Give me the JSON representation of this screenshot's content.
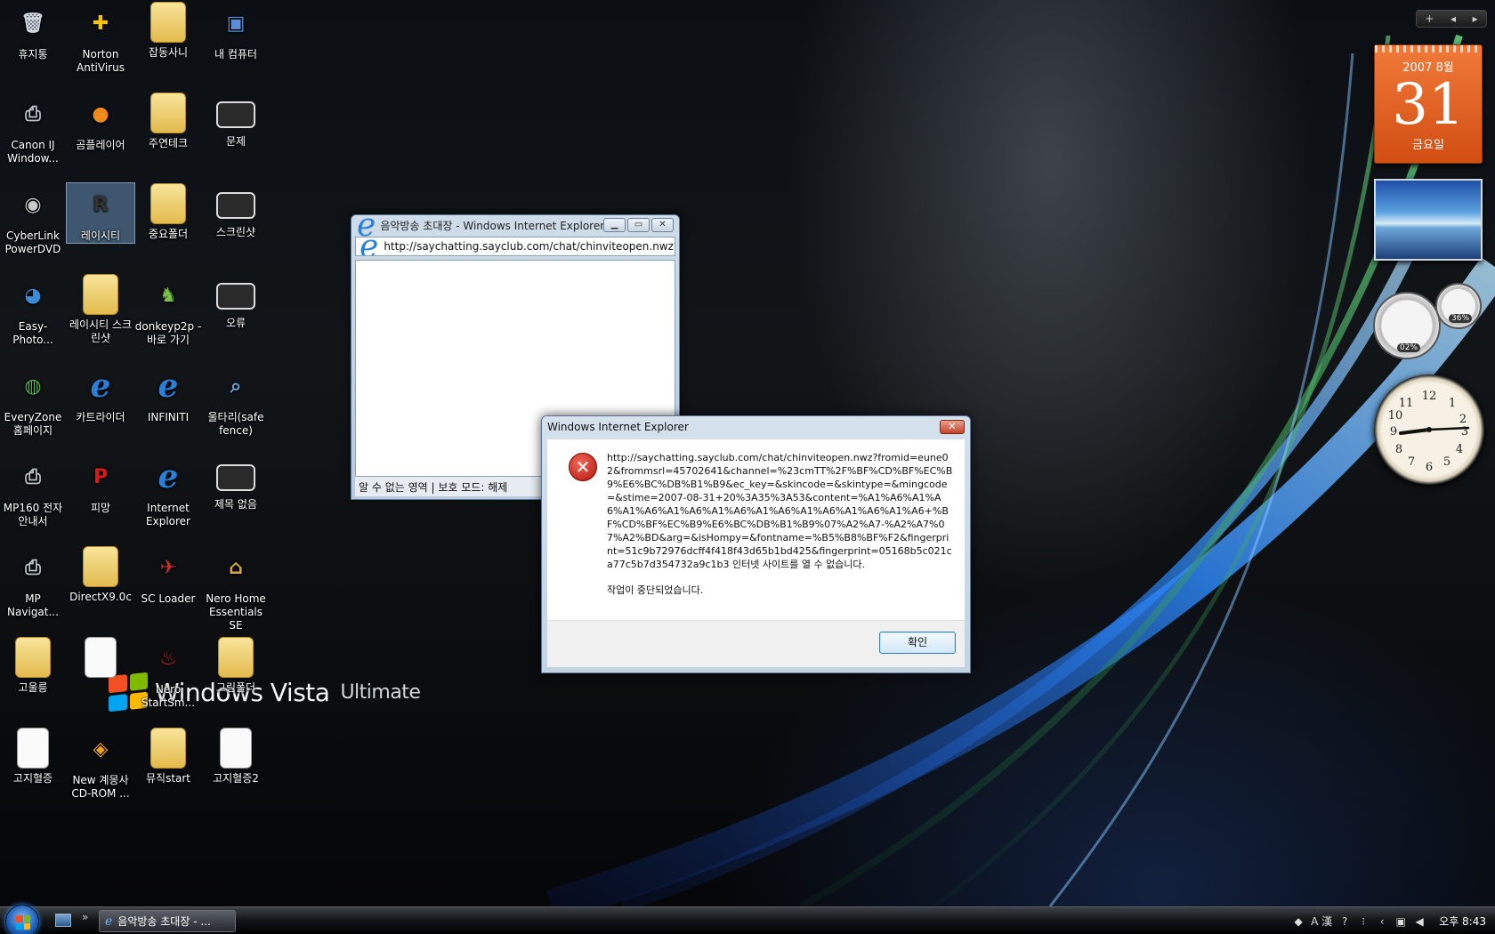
{
  "desktop": {
    "icons": [
      {
        "label": "휴지통",
        "icon": "recycle-bin-icon"
      },
      {
        "label": "Norton AntiVirus",
        "icon": "norton-icon"
      },
      {
        "label": "잡동사니",
        "icon": "folder-icon"
      },
      {
        "label": "내 컴퓨터",
        "icon": "computer-icon"
      },
      {
        "label": "Canon IJ Window...",
        "icon": "printer-icon"
      },
      {
        "label": "곰플레이어",
        "icon": "gom-player-icon"
      },
      {
        "label": "주연테크",
        "icon": "folder-icon"
      },
      {
        "label": "문제",
        "icon": "screenshot-icon"
      },
      {
        "label": "CyberLink PowerDVD",
        "icon": "dvd-icon"
      },
      {
        "label": "레이시티",
        "icon": "racity-icon"
      },
      {
        "label": "중요폴더",
        "icon": "folder-icon"
      },
      {
        "label": "스크린샷",
        "icon": "screenshot-icon"
      },
      {
        "label": "Easy-Photo...",
        "icon": "photo-icon"
      },
      {
        "label": "레이시티 스크린샷",
        "icon": "folder-icon"
      },
      {
        "label": "donkeyp2p - 바로 가기",
        "icon": "donkey-icon"
      },
      {
        "label": "오류",
        "icon": "screenshot-icon"
      },
      {
        "label": "EveryZone 홈페이지",
        "icon": "globe-icon"
      },
      {
        "label": "카트라이더",
        "icon": "ie-icon"
      },
      {
        "label": "INFINITI",
        "icon": "ie-icon"
      },
      {
        "label": "울타리(safe fence)",
        "icon": "magnifier-icon"
      },
      {
        "label": "MP160 전자 안내서",
        "icon": "printer-icon"
      },
      {
        "label": "피망",
        "icon": "pmang-icon"
      },
      {
        "label": "Internet Explorer",
        "icon": "ie-icon"
      },
      {
        "label": "제목 없음",
        "icon": "screenshot-icon"
      },
      {
        "label": "MP Navigat...",
        "icon": "printer-icon"
      },
      {
        "label": "DirectX9.0c",
        "icon": "folder-icon"
      },
      {
        "label": "SC Loader",
        "icon": "plane-icon"
      },
      {
        "label": "Nero Home Essentials SE",
        "icon": "nero-home-icon"
      },
      {
        "label": "고울릉",
        "icon": "folder-icon"
      },
      {
        "label": "",
        "icon": "document-icon"
      },
      {
        "label": "Nero StartSm...",
        "icon": "nero-icon"
      },
      {
        "label": "그림폴더",
        "icon": "folder-icon"
      },
      {
        "label": "고지혈증",
        "icon": "document-icon"
      },
      {
        "label": "New 계몽사 CD-ROM ...",
        "icon": "cdrom-icon"
      },
      {
        "label": "뮤직start",
        "icon": "folder-icon"
      },
      {
        "label": "고지혈증2",
        "icon": "document-icon"
      }
    ],
    "wallpaper_brand": "Windows Vista",
    "wallpaper_edition": "Ultimate"
  },
  "ie_window": {
    "title": "음악방송 초대장 - Windows Internet Explorer",
    "address": "http://saychatting.sayclub.com/chat/chinviteopen.nwz?fron",
    "status": "알 수 없는 영역 | 보호 모드: 해제"
  },
  "dialog": {
    "title": "Windows Internet Explorer",
    "message": "http://saychatting.sayclub.com/chat/chinviteopen.nwz?fromid=eune02&frommsrl=45702641&channel=%23cmTT%2F%BF%CD%BF%EC%B9%E6%BC%DB%B1%B9&ec_key=&skincode=&skintype=&mingcode=&stime=2007-08-31+20%3A35%3A53&content=%A1%A6%A1%A6%A1%A6%A1%A6%A1%A6%A1%A6%A1%A6%A1%A6%A1%A6+%BF%CD%BF%EC%B9%E6%BC%DB%B1%B9%07%A2%A7-%A2%A7%07%A2%BD&arg=&isHompy=&fontname=%B5%B8%BF%F2&fingerprint=51c9b72976dcff4f418f43d65b1bd425&fingerprint=05168b5c021ca77c5b7d354732a9c1b3 인터넷 사이트를 열 수 없습니다.",
    "message2": "작업이 중단되었습니다.",
    "ok_label": "확인",
    "icon": "error-icon"
  },
  "sidebar": {
    "calendar": {
      "year_month": "2007 8월",
      "day": "31",
      "weekday": "금요일"
    },
    "cpu_meter": {
      "cpu": "02%",
      "memory": "36%"
    }
  },
  "taskbar": {
    "task_label": "음악방송 초대장 - ...",
    "clock": "오후 8:43",
    "ime": "A 漢"
  },
  "colors": {
    "calendar": "#e0601f",
    "dialog_frame": "#c3d3e2",
    "accent_blue": "#2a7fd8"
  }
}
